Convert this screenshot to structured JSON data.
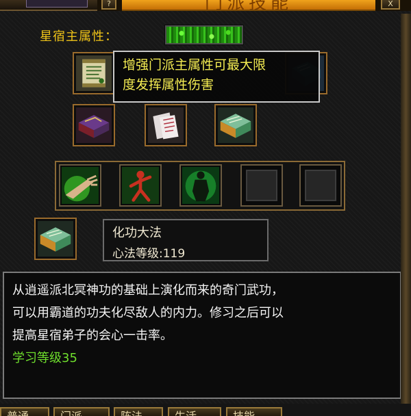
{
  "window": {
    "title": "门派技能",
    "close_glyph": "X",
    "left_button_glyph": "?"
  },
  "attribute": {
    "label": "星宿主属性："
  },
  "tooltip": {
    "lines": [
      "增强门派主属性可最大限",
      "度发挥属性伤害"
    ]
  },
  "skill_icons": [
    {
      "name": "scroll-icon"
    },
    {
      "name": "rune-book-icon"
    },
    {
      "name": "purple-tome-icon"
    },
    {
      "name": "paper-manual-icon"
    },
    {
      "name": "jade-tome-icon"
    }
  ],
  "equip_slots": [
    {
      "name": "palm-strike-icon",
      "empty": false
    },
    {
      "name": "meridian-figure-icon",
      "empty": false
    },
    {
      "name": "poison-body-icon",
      "empty": false
    },
    {
      "name": "empty-slot-icon",
      "empty": true
    },
    {
      "name": "empty-slot-icon",
      "empty": true
    }
  ],
  "selected_skill": {
    "name": "化功大法",
    "level_text": "心法等级:119",
    "icon": "jade-tome-icon"
  },
  "description": {
    "lines": [
      "从逍遥派北冥神功的基础上演化而来的奇门武功，",
      "可以用霸道的功夫化尽敌人的内力。修习之后可以",
      "提高星宿弟子的会心一击率。"
    ],
    "learn_level": "学习等级35"
  },
  "tabs": [
    "普通",
    "门派",
    "阵法",
    "生活",
    "技能"
  ],
  "colors": {
    "title_orange": "#e08a12",
    "label_yellow": "#f0c418",
    "tooltip_yellow": "#f4ec52",
    "learn_green": "#6fdf2d",
    "frame_bronze": "#9a6b2c"
  }
}
